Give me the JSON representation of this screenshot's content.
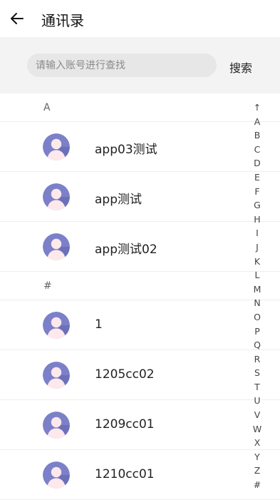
{
  "header": {
    "title": "通讯录"
  },
  "search": {
    "placeholder": "请输入账号进行查找",
    "value": "",
    "button_label": "搜索"
  },
  "sections": [
    {
      "letter": "A",
      "contacts": [
        {
          "name": "app03测试"
        },
        {
          "name": "app测试"
        },
        {
          "name": "app测试02"
        }
      ]
    },
    {
      "letter": "#",
      "contacts": [
        {
          "name": "1"
        },
        {
          "name": "1205cc02"
        },
        {
          "name": "1209cc01"
        },
        {
          "name": "1210cc01"
        }
      ]
    }
  ],
  "index": [
    "↑",
    "A",
    "B",
    "C",
    "D",
    "E",
    "F",
    "G",
    "H",
    "I",
    "J",
    "K",
    "L",
    "M",
    "N",
    "O",
    "P",
    "Q",
    "R",
    "S",
    "T",
    "U",
    "V",
    "W",
    "X",
    "Y",
    "Z",
    "#"
  ],
  "colors": {
    "avatar_bg": "#7b80c8",
    "avatar_fg": "#fde8ec",
    "search_bg": "#f3f3f3",
    "search_field_bg": "#e7e7e7"
  },
  "icons": {
    "back": "arrow-left-icon",
    "avatar": "default-avatar-icon"
  }
}
